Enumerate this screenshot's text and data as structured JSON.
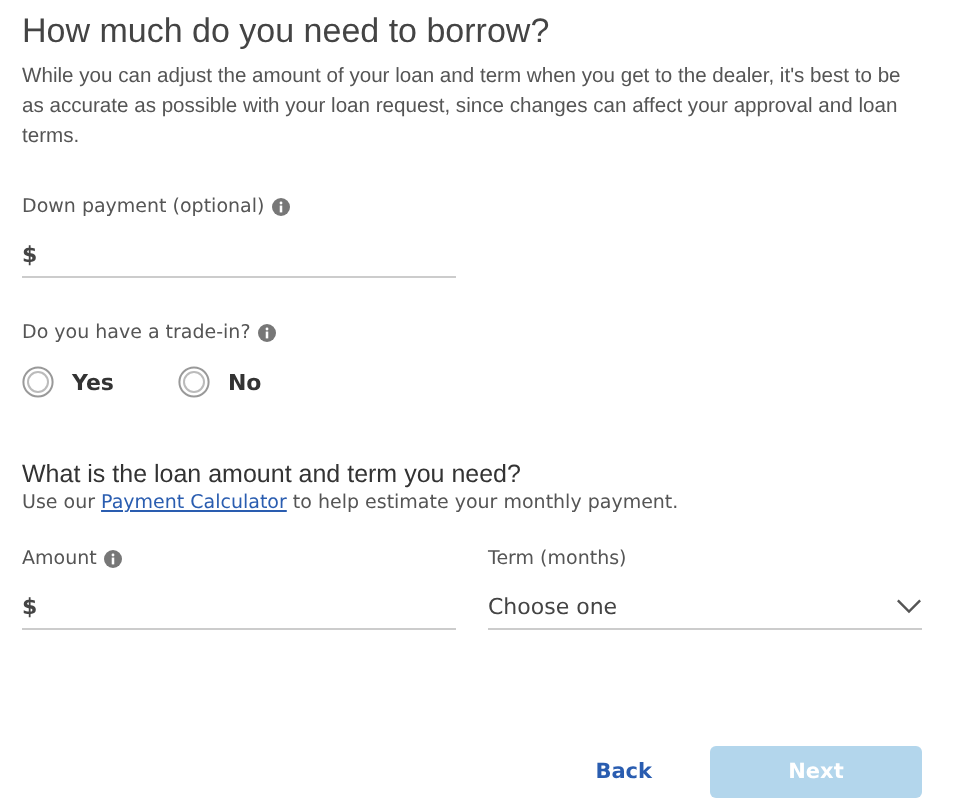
{
  "title": "How much do you need to borrow?",
  "intro": "While you can adjust the amount of your loan and term when you get to the dealer, it's best to be as accurate as possible with your loan request, since changes can affect your approval and loan terms.",
  "down_payment": {
    "label": "Down payment (optional)",
    "prefix": "$"
  },
  "trade_in": {
    "label": "Do you have a trade-in?",
    "options": [
      {
        "label": "Yes",
        "selected": false
      },
      {
        "label": "No",
        "selected": false
      }
    ]
  },
  "loan": {
    "heading": "What is the loan amount and term you need?",
    "hint_before": "Use our",
    "hint_link": "Payment Calculator",
    "hint_after": "to help estimate your monthly payment.",
    "amount": {
      "label": "Amount",
      "prefix": "$"
    },
    "term": {
      "label": "Term (months)",
      "value": "Choose one"
    }
  },
  "buttons": {
    "back": "Back",
    "next": {
      "label": "Next",
      "disabled": true
    }
  }
}
